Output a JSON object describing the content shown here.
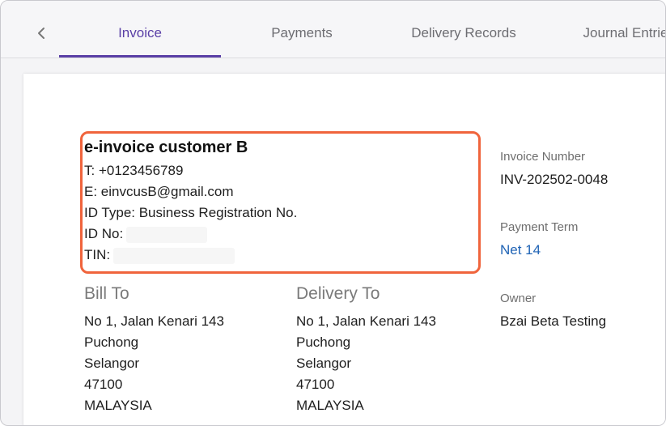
{
  "tabs": [
    {
      "label": "Invoice",
      "active": true
    },
    {
      "label": "Payments",
      "active": false
    },
    {
      "label": "Delivery Records",
      "active": false
    },
    {
      "label": "Journal Entrie",
      "active": false
    }
  ],
  "back_icon": "chevron-left-icon",
  "customer": {
    "name": "e-invoice customer B",
    "phone": "T: +0123456789",
    "email": "E: einvcusB@gmail.com",
    "id_type": "ID Type: Business Registration No.",
    "id_no_label": "ID No:",
    "tin_label": "TIN:"
  },
  "bill_to": {
    "heading": "Bill To",
    "lines": [
      "No 1, Jalan Kenari 143",
      "Puchong",
      "Selangor",
      "47100",
      "MALAYSIA"
    ]
  },
  "delivery_to": {
    "heading": "Delivery To",
    "lines": [
      "No 1, Jalan Kenari 143",
      "Puchong",
      "Selangor",
      "47100",
      "MALAYSIA"
    ]
  },
  "side": {
    "invoice_number_label": "Invoice Number",
    "invoice_number": "INV-202502-0048",
    "payment_term_label": "Payment Term",
    "payment_term": "Net 14",
    "owner_label": "Owner",
    "owner": "Bzai Beta Testing"
  },
  "colors": {
    "accent": "#5a3fa6",
    "highlight": "#f0643c",
    "link": "#1f63b5"
  }
}
